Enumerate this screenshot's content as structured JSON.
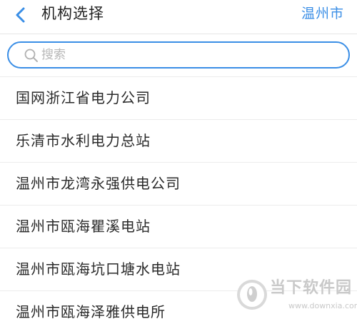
{
  "header": {
    "back_icon": "chevron-left-icon",
    "title": "机构选择",
    "city": "温州市",
    "accent_color": "#3a8ee6"
  },
  "search": {
    "icon": "search-icon",
    "placeholder": "搜索",
    "value": ""
  },
  "institutions": [
    "国网浙江省电力公司",
    "乐清市水利电力总站",
    "温州市龙湾永强供电公司",
    "温州市瓯海瞿溪电站",
    "温州市瓯海坑口塘水电站",
    "温州市瓯海泽雅供电所"
  ],
  "watermark": {
    "name": "当下软件园",
    "url": "www.downxia.com"
  }
}
